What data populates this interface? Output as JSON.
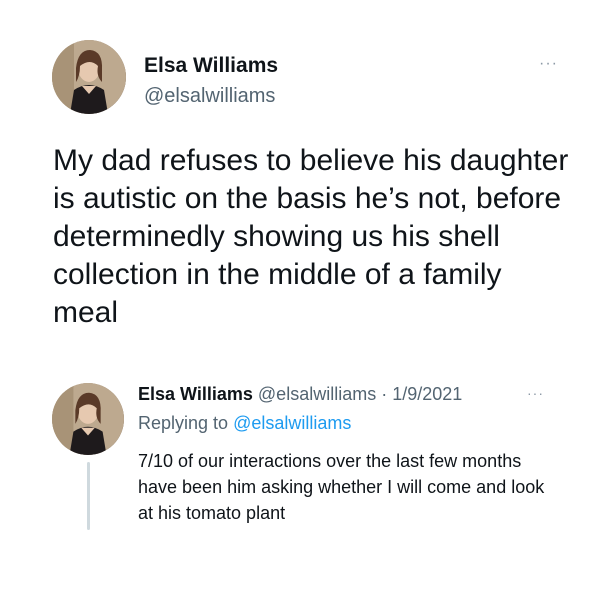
{
  "main_tweet": {
    "author_name": "Elsa Williams",
    "author_handle": "@elsalwilliams",
    "more_label": "···",
    "text": "My dad refuses to believe his daughter is autistic on the basis he’s not, before determinedly showing us his shell collection in the middle of a family meal"
  },
  "reply_tweet": {
    "author_name": "Elsa Williams",
    "meta": "@elsalwilliams · 1/9/2021",
    "more_label": "···",
    "replying_prefix": "Replying to",
    "replying_handle": "@elsalwilliams",
    "text": "7/10 of our interactions over the last few months have been him asking whether I will come and look at his tomato plant"
  },
  "colors": {
    "text": "#0f1419",
    "secondary": "#536471",
    "link": "#1d9bf0",
    "thread_line": "#cfd9de"
  }
}
